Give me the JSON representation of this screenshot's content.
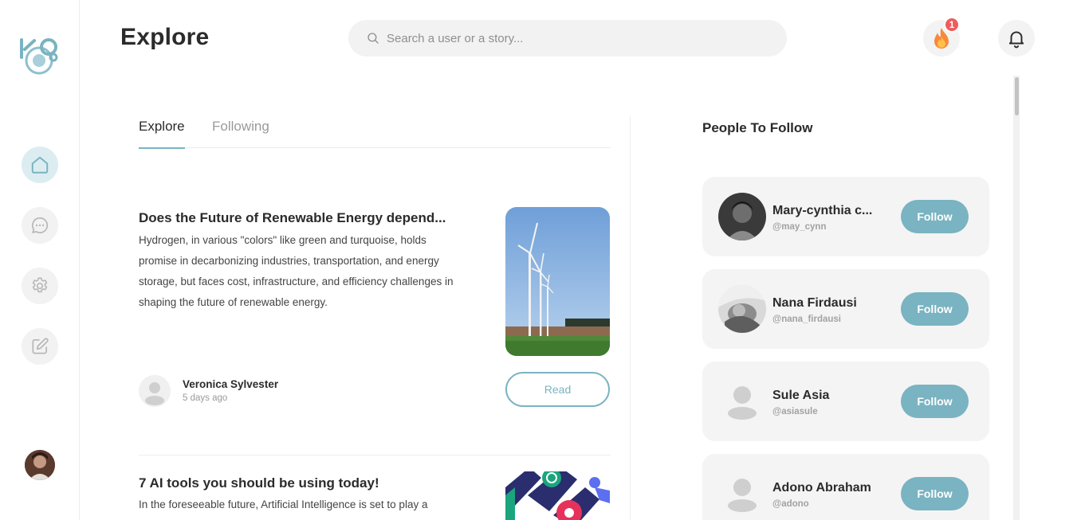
{
  "header": {
    "title": "Explore",
    "search_placeholder": "Search a user or a story...",
    "streak_count": "1"
  },
  "sidebar": {
    "items": [
      {
        "name": "home",
        "icon": "home-icon",
        "active": true
      },
      {
        "name": "messages",
        "icon": "chat-icon",
        "active": false
      },
      {
        "name": "settings",
        "icon": "gear-icon",
        "active": false
      },
      {
        "name": "write",
        "icon": "edit-icon",
        "active": false
      }
    ]
  },
  "tabs": [
    {
      "label": "Explore",
      "active": true
    },
    {
      "label": "Following",
      "active": false
    }
  ],
  "articles": [
    {
      "title": "Does the Future of Renewable Energy depend...",
      "description": "Hydrogen, in various \"colors\" like green and turquoise, holds promise in decarbonizing industries, transportation, and energy storage, but faces cost, infrastructure, and efficiency challenges in shaping the future of renewable energy.",
      "author": "Veronica Sylvester",
      "time": "5 days ago",
      "read_label": "Read"
    },
    {
      "title": "7 AI tools you should be using today!",
      "description": "In the foreseeable future, Artificial Intelligence is set to play a"
    }
  ],
  "people_to_follow": {
    "title": "People To Follow",
    "people": [
      {
        "name": "Mary-cynthia c...",
        "handle": "@may_cynn",
        "follow_label": "Follow"
      },
      {
        "name": "Nana Firdausi",
        "handle": "@nana_firdausi",
        "follow_label": "Follow"
      },
      {
        "name": "Sule Asia",
        "handle": "@asiasule",
        "follow_label": "Follow"
      },
      {
        "name": "Adono Abraham",
        "handle": "@adono",
        "follow_label": "Follow"
      }
    ]
  },
  "colors": {
    "accent": "#7ab3c1",
    "badge": "#ef5b5b",
    "card_bg": "#f4f4f4"
  }
}
